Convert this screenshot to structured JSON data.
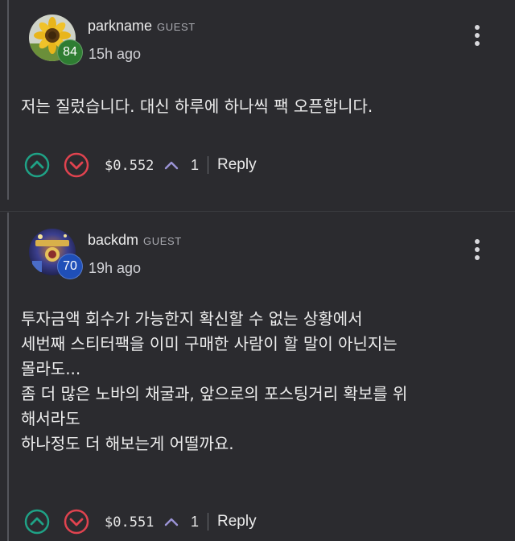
{
  "colors": {
    "upvote": "#1fa286",
    "downvote": "#e0434f",
    "voters_caret": "#9b93d6",
    "badge_green": "#2e7d32",
    "badge_blue": "#1f4fb8"
  },
  "comments": [
    {
      "username": "parkname",
      "role_tag": "GUEST",
      "level": "84",
      "timestamp": "15h ago",
      "avatar_icon": "sunflower-avatar",
      "body_lines": [
        "저는 질렀습니다. 대신 하루에 하나씩 팩 오픈합니다."
      ],
      "payout": "$0.552",
      "vote_count": "1",
      "reply_label": "Reply"
    },
    {
      "username": "backdm",
      "role_tag": "GUEST",
      "level": "70",
      "timestamp": "19h ago",
      "avatar_icon": "game-art-avatar",
      "body_lines": [
        "투자금액 회수가 가능한지 확신할 수 없는 상황에서",
        "세번째 스티터팩을 이미 구매한 사람이 할 말이 아닌지는",
        "몰라도...",
        "좀 더 많은 노바의 채굴과, 앞으로의 포스팅거리 확보를 위",
        "해서라도",
        "하나정도 더 해보는게 어떨까요."
      ],
      "payout": "$0.551",
      "vote_count": "1",
      "reply_label": "Reply"
    }
  ]
}
